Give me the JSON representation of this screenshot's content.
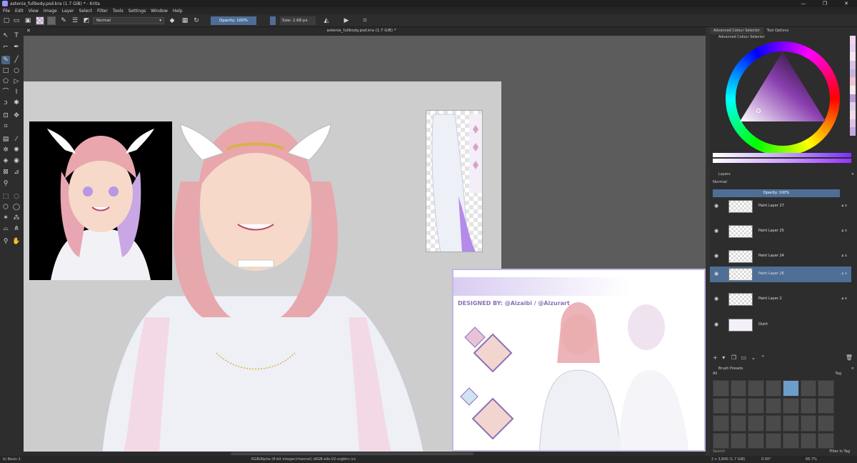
{
  "window": {
    "title": "astenia_fullbody.psd.kra (1.7 GiB) * - Krita",
    "controls": [
      "—",
      "❐",
      "✕"
    ]
  },
  "menu": [
    "File",
    "Edit",
    "View",
    "Image",
    "Layer",
    "Select",
    "Filter",
    "Tools",
    "Settings",
    "Window",
    "Help"
  ],
  "toolbar": {
    "blend_mode": "Normal",
    "opacity": "Opacity: 100%",
    "size": "Size: 2.68 px"
  },
  "document": {
    "tab_title": "astenia_fullbody.psd.kra (1.7 GiB) *",
    "reference_text": "DESIGNED BY: @Aizaibi / @Aizurart"
  },
  "dock": {
    "tabs": [
      "Advanced Colour Selector",
      "Tool Options"
    ],
    "colour_header": "Advanced Colour Selector",
    "layers_header": "Layers",
    "layer_blend": "Normal",
    "layer_opacity": "Opacity: 100%",
    "layers": [
      {
        "name": "Paint Layer 27",
        "selected": false
      },
      {
        "name": "Paint Layer 25",
        "selected": false
      },
      {
        "name": "Paint Layer 24",
        "selected": false
      },
      {
        "name": "Paint Layer 26",
        "selected": true
      },
      {
        "name": "Paint Layer 2",
        "selected": false
      },
      {
        "name": "Outrt",
        "selected": false
      }
    ],
    "brush_header": "Brush Presets",
    "brush_filter": "All",
    "brush_tag": "Tag",
    "brush_search": "Search",
    "filter_in_tag": "Filter in Tag"
  },
  "statusbar": {
    "brush": "b) Basic-1",
    "colorspace": "RGB/Alpha (8-bit integer/channel)  sRGB-elle-V2-srgbtrc.icc",
    "size": "2 x 3,840 (1.7 GiB)",
    "rotation": "0.00°",
    "zoom": "66.7%"
  },
  "colors": {
    "accent": "#4e6e96",
    "canvas_bg": "#5c5c5c",
    "document_bg": "#cdcdcd"
  }
}
